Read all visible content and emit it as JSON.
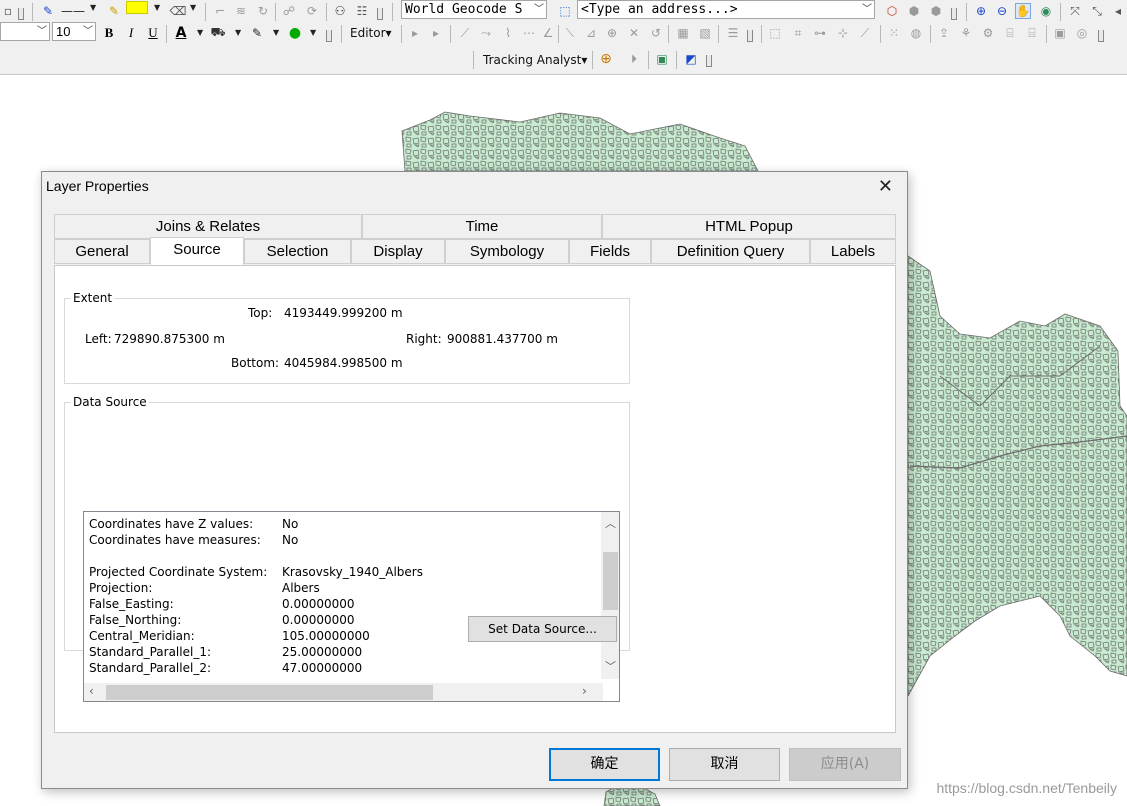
{
  "toolbar": {
    "font_size_value": "10",
    "font_style": {
      "bold": "B",
      "italic": "I",
      "underline": "U"
    },
    "fill_color": "#ffff00",
    "font_color": "#000000",
    "line_color": "#00aa00",
    "geocode_combo": "World Geocode S",
    "address_combo": "<Type an address...>",
    "editor_menu": "Editor",
    "tracking_analyst_menu": "Tracking Analyst"
  },
  "map": {
    "fill_color": "#c8ecd0",
    "line_color": "#6b6b6b"
  },
  "dialog": {
    "title": "Layer Properties",
    "tabs_top": [
      "Joins & Relates",
      "Time",
      "HTML Popup"
    ],
    "tabs_bottom": [
      "General",
      "Source",
      "Selection",
      "Display",
      "Symbology",
      "Fields",
      "Definition Query",
      "Labels"
    ],
    "active_tab": "Source",
    "extent": {
      "title": "Extent",
      "top_label": "Top:",
      "top_value": "4193449.999200 m",
      "left_label": "Left:",
      "left_value": "729890.875300 m",
      "right_label": "Right:",
      "right_value": "900881.437700 m",
      "bottom_label": "Bottom:",
      "bottom_value": "4045984.998500 m"
    },
    "data_source": {
      "title": "Data Source",
      "rows": [
        {
          "key": "Coordinates have Z values:",
          "value": "No"
        },
        {
          "key": "Coordinates have measures:",
          "value": "No"
        },
        {
          "key": "",
          "value": ""
        },
        {
          "key": "Projected Coordinate System:",
          "value": "Krasovsky_1940_Albers"
        },
        {
          "key": "Projection:",
          "value": "Albers"
        },
        {
          "key": "False_Easting:",
          "value": "0.00000000"
        },
        {
          "key": "False_Northing:",
          "value": "0.00000000"
        },
        {
          "key": "Central_Meridian:",
          "value": "105.00000000"
        },
        {
          "key": "Standard_Parallel_1:",
          "value": "25.00000000"
        },
        {
          "key": "Standard_Parallel_2:",
          "value": "47.00000000"
        }
      ],
      "set_button": "Set Data Source..."
    },
    "buttons": {
      "ok": "确定",
      "cancel": "取消",
      "apply": "应用(A)"
    }
  },
  "watermark": "https://blog.csdn.net/Tenbeily"
}
